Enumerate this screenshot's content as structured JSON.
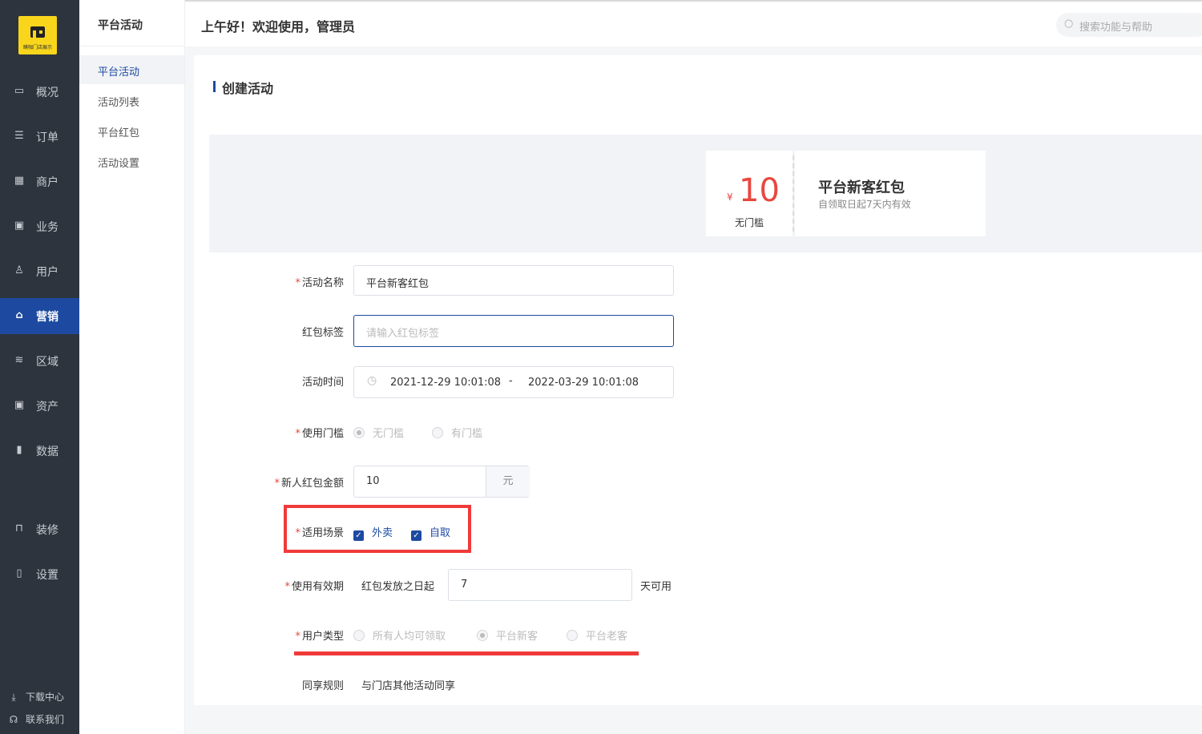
{
  "logo": {
    "text": "瞒咖门店展示"
  },
  "sidebar": {
    "items": [
      {
        "label": "概况",
        "icon": "monitor-icon"
      },
      {
        "label": "订单",
        "icon": "document-icon"
      },
      {
        "label": "商户",
        "icon": "store-icon"
      },
      {
        "label": "业务",
        "icon": "briefcase-icon"
      },
      {
        "label": "用户",
        "icon": "user-icon"
      },
      {
        "label": "营销",
        "icon": "marketing-icon"
      },
      {
        "label": "区域",
        "icon": "database-icon"
      },
      {
        "label": "资产",
        "icon": "wallet-icon"
      },
      {
        "label": "数据",
        "icon": "bar-chart-icon"
      },
      {
        "label": "装修",
        "icon": "brush-icon"
      },
      {
        "label": "设置",
        "icon": "settings-icon"
      }
    ],
    "active_index": 5,
    "footer": [
      {
        "label": "下载中心",
        "icon": "download-icon"
      },
      {
        "label": "联系我们",
        "icon": "headset-icon"
      }
    ]
  },
  "submenu": {
    "title": "平台活动",
    "items": [
      "平台活动",
      "活动列表",
      "平台红包",
      "活动设置"
    ],
    "active_index": 0
  },
  "header": {
    "greeting": "上午好！欢迎使用，管理员",
    "search_placeholder": "搜索功能与帮助"
  },
  "page": {
    "section_title": "创建活动",
    "coupon": {
      "currency": "¥",
      "amount": "10",
      "threshold": "无门槛",
      "title": "平台新客红包",
      "desc": "自领取日起7天内有效"
    },
    "form": {
      "name": {
        "label": "活动名称",
        "value": "平台新客红包",
        "required": true
      },
      "tag": {
        "label": "红包标签",
        "placeholder": "请输入红包标签"
      },
      "time": {
        "label": "活动时间",
        "start": "2021-12-29 10:01:08",
        "sep": "-",
        "end": "2022-03-29 10:01:08"
      },
      "threshold": {
        "label": "使用门槛",
        "options": [
          "无门槛",
          "有门槛"
        ],
        "selected": 0,
        "required": true
      },
      "amount": {
        "label": "新人红包金额",
        "value": "10",
        "unit": "元",
        "required": true
      },
      "scene": {
        "label": "适用场景",
        "options": [
          "外卖",
          "自取"
        ],
        "checked": [
          true,
          true
        ],
        "required": true
      },
      "validity": {
        "label": "使用有效期",
        "prefix": "红包发放之日起",
        "value": "7",
        "suffix": "天可用",
        "required": true
      },
      "user_type": {
        "label": "用户类型",
        "options": [
          "所有人均可领取",
          "平台新客",
          "平台老客"
        ],
        "selected": 1,
        "required": true
      },
      "share": {
        "label": "同享规则",
        "value": "与门店其他活动同享"
      }
    },
    "highlight_color": "#f03a3a",
    "accent_color": "#1d4aa0"
  }
}
